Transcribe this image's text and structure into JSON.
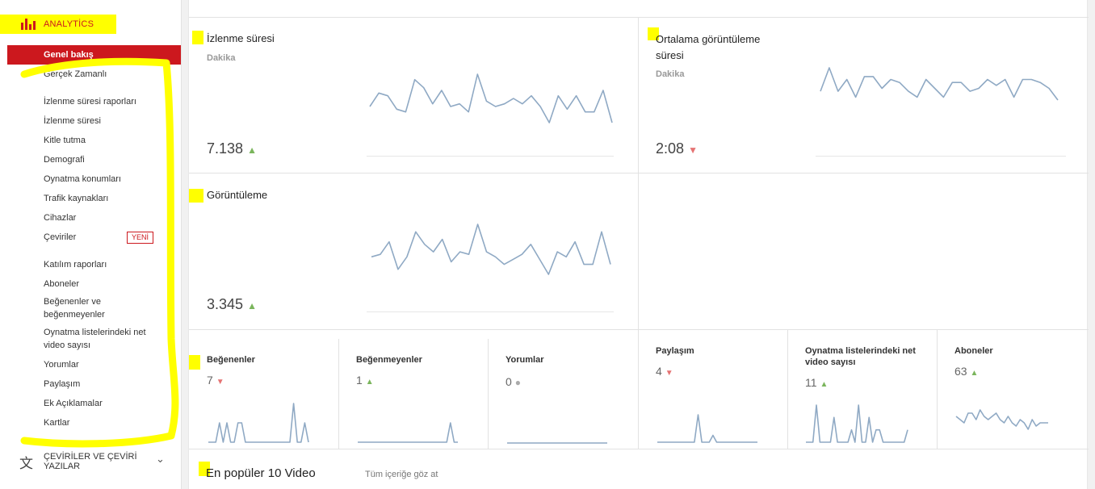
{
  "sidebar": {
    "header": "ANALYTİCS",
    "active": "Genel bakış",
    "items": [
      "Gerçek Zamanlı",
      "İzlenme süresi raporları",
      "İzlenme süresi",
      "Kitle tutma",
      "Demografi",
      "Oynatma konumları",
      "Trafik kaynakları",
      "Cihazlar",
      "Çeviriler",
      "Katılım raporları",
      "Aboneler",
      "Beğenenler ve beğenmeyenler",
      "Oynatma listelerindeki net video sayısı",
      "Yorumlar",
      "Paylaşım",
      "Ek Açıklamalar",
      "Kartlar"
    ],
    "new_badge": "YENİ",
    "translations": "ÇEVİRİLER VE ÇEVİRİ YAZILAR",
    "icons": {
      "analytics": "bar-chart-icon",
      "translate": "translate-icon",
      "expand": "chevron-down-icon"
    }
  },
  "cards": {
    "watch_time": {
      "title": "İzlenme süresi",
      "sub": "Dakika",
      "value": "7.138",
      "trend": "up"
    },
    "avg_duration": {
      "title": "Ortalama görüntüleme süresi",
      "sub": "Dakika",
      "value": "2:08",
      "trend": "down"
    },
    "views": {
      "title": "Görüntüleme",
      "value": "3.345",
      "trend": "up"
    }
  },
  "mini": {
    "likes": {
      "title": "Beğenenler",
      "value": "7",
      "trend": "down"
    },
    "dislikes": {
      "title": "Beğenmeyenler",
      "value": "1",
      "trend": "up"
    },
    "comments": {
      "title": "Yorumlar",
      "value": "0",
      "trend": "flat"
    },
    "shares": {
      "title": "Paylaşım",
      "value": "4",
      "trend": "down"
    },
    "playlists": {
      "title": "Oynatma listelerindeki net video sayısı",
      "value": "11",
      "trend": "up"
    },
    "subscribers": {
      "title": "Aboneler",
      "value": "63",
      "trend": "up"
    }
  },
  "top10": {
    "title": "En popüler 10 Video",
    "link": "Tüm içeriğe göz at"
  },
  "colors": {
    "accent": "#cc181e",
    "spark": "#8fa9c4",
    "up": "#7ab55c",
    "down": "#e57373",
    "highlight": "#ffff00"
  },
  "chart_data": [
    {
      "type": "line",
      "name": "watch_time",
      "values": [
        4,
        9,
        8,
        3,
        2,
        14,
        11,
        5,
        10,
        4,
        5,
        2,
        16,
        6,
        4,
        5,
        7,
        5,
        8,
        4,
        -2,
        8,
        3,
        8,
        2,
        2,
        10,
        -2
      ]
    },
    {
      "type": "line",
      "name": "avg_duration",
      "values": [
        8,
        16,
        8,
        12,
        6,
        13,
        13,
        9,
        12,
        11,
        8,
        6,
        12,
        9,
        6,
        11,
        11,
        8,
        9,
        12,
        10,
        12,
        6,
        12,
        12,
        11,
        9,
        5
      ]
    },
    {
      "type": "line",
      "name": "views",
      "values": [
        5,
        6,
        11,
        0,
        5,
        15,
        10,
        7,
        12,
        3,
        7,
        6,
        18,
        7,
        5,
        2,
        4,
        6,
        10,
        4,
        -2,
        7,
        5,
        11,
        2,
        2,
        15,
        2
      ]
    },
    {
      "type": "line",
      "name": "likes",
      "values": [
        0,
        0,
        0,
        1,
        0,
        1,
        0,
        0,
        1,
        1,
        0,
        0,
        0,
        0,
        0,
        0,
        0,
        0,
        0,
        0,
        0,
        0,
        0,
        2,
        0,
        0,
        1,
        0
      ]
    },
    {
      "type": "line",
      "name": "dislikes",
      "values": [
        0,
        0,
        0,
        0,
        0,
        0,
        0,
        0,
        0,
        0,
        0,
        0,
        0,
        0,
        0,
        0,
        0,
        0,
        0,
        0,
        0,
        0,
        0,
        0,
        0,
        1,
        0,
        0
      ]
    },
    {
      "type": "line",
      "name": "comments",
      "values": [
        0,
        0,
        0,
        0,
        0,
        0,
        0,
        0,
        0,
        0,
        0,
        0,
        0,
        0,
        0,
        0,
        0,
        0,
        0,
        0,
        0,
        0,
        0,
        0,
        0,
        0,
        0,
        0
      ]
    },
    {
      "type": "line",
      "name": "shares",
      "values": [
        0,
        0,
        0,
        0,
        0,
        0,
        0,
        0,
        0,
        0,
        0,
        2,
        0,
        0,
        0,
        0.5,
        0,
        0,
        0,
        0,
        0,
        0,
        0,
        0,
        0,
        0,
        0,
        0
      ]
    },
    {
      "type": "line",
      "name": "playlists",
      "values": [
        0,
        0,
        0,
        3,
        0,
        0,
        0,
        0,
        2,
        0,
        0,
        0,
        0,
        1,
        0,
        3,
        0,
        0,
        2,
        0,
        1,
        1,
        0,
        0,
        0,
        0,
        0,
        0,
        0,
        1
      ]
    },
    {
      "type": "line",
      "name": "subscribers",
      "values": [
        5,
        4,
        3,
        6,
        6,
        4,
        7,
        5,
        4,
        5,
        6,
        4,
        3,
        5,
        3,
        2,
        4,
        3,
        1,
        4,
        2,
        3,
        3,
        3
      ]
    }
  ]
}
